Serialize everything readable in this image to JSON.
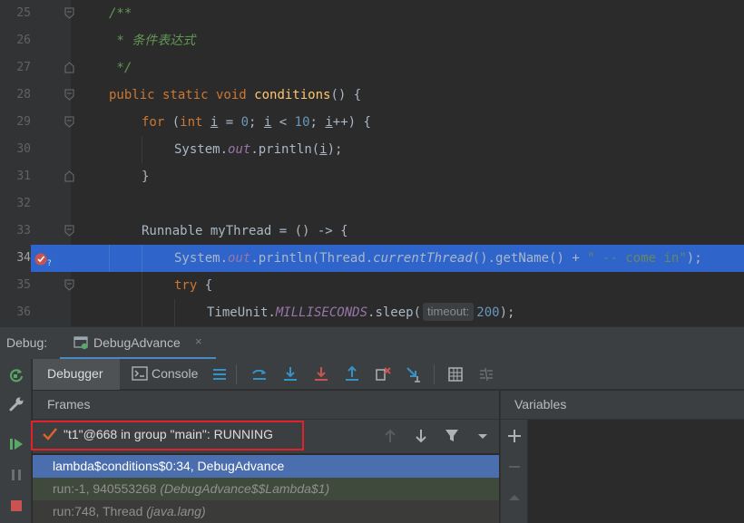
{
  "editor": {
    "lines": [
      {
        "num": "25"
      },
      {
        "num": "26"
      },
      {
        "num": "27"
      },
      {
        "num": "28"
      },
      {
        "num": "29"
      },
      {
        "num": "30"
      },
      {
        "num": "31"
      },
      {
        "num": "32"
      },
      {
        "num": "33"
      },
      {
        "num": "34"
      },
      {
        "num": "35"
      },
      {
        "num": "36"
      }
    ],
    "current_line": "34",
    "tokens": {
      "l25_comment": "/**",
      "l26_comment": " * 条件表达式",
      "l27_comment": " */",
      "l28_mods": "public static void ",
      "l28_name": "conditions",
      "l28_rest": "() {",
      "l29_for": "for ",
      "l29_p1": "(",
      "l29_int": "int ",
      "l29_i1": "i",
      "l29_p2": " = ",
      "l29_n0": "0",
      "l29_p3": "; ",
      "l29_i2": "i",
      "l29_p4": " < ",
      "l29_n10": "10",
      "l29_p5": "; ",
      "l29_i3": "i",
      "l29_p6": "++) {",
      "l30_sys": "System.",
      "l30_out": "out",
      "l30_call": ".println(",
      "l30_i": "i",
      "l30_end": ");",
      "l31_brace": "}",
      "l33_text": "Runnable myThread = () -> {",
      "l34_sys": "System.",
      "l34_out": "out",
      "l34_call": ".println(Thread.",
      "l34_ct": "currentThread",
      "l34_mid": "().getName() + ",
      "l34_str": "\" -- come in\"",
      "l34_end": ");",
      "l35_try": "try",
      "l35_brace": " {",
      "l36_unit": "TimeUnit.",
      "l36_ms": "MILLISECONDS",
      "l36_sleep": ".sleep(",
      "l36_hint": "timeout:",
      "l36_val": "200",
      "l36_end": ");"
    }
  },
  "debug": {
    "title": "Debug:",
    "session_tab": "DebugAdvance",
    "session_close": "×",
    "tabs": {
      "debugger": "Debugger",
      "console": "Console"
    },
    "frames": {
      "header": "Frames",
      "thread": "\"t1\"@668 in group \"main\": RUNNING",
      "rows": [
        {
          "main": "lambda$conditions$0:34, DebugAdvance",
          "pkg": ""
        },
        {
          "main": "run:-1, 940553268 ",
          "pkg": "(DebugAdvance$$Lambda$1)"
        },
        {
          "main": "run:748, Thread ",
          "pkg": "(java.lang)"
        }
      ]
    },
    "variables": {
      "header": "Variables"
    }
  },
  "colors": {
    "accent": "#4a88c7",
    "selection": "#4b6eaf",
    "execution_line": "#2f65ca",
    "highlight_box": "#e0232b"
  },
  "icons": {
    "left_toolbar": [
      "rerun-icon",
      "settings-wrench-icon",
      "resume-icon",
      "pause-icon",
      "stop-icon"
    ],
    "toolbar": [
      "show-execution-point-icon",
      "step-over-icon",
      "step-into-icon",
      "force-step-into-icon",
      "step-out-icon",
      "drop-frame-icon",
      "run-to-cursor-icon",
      "evaluate-expression-icon",
      "trace-icon"
    ]
  }
}
